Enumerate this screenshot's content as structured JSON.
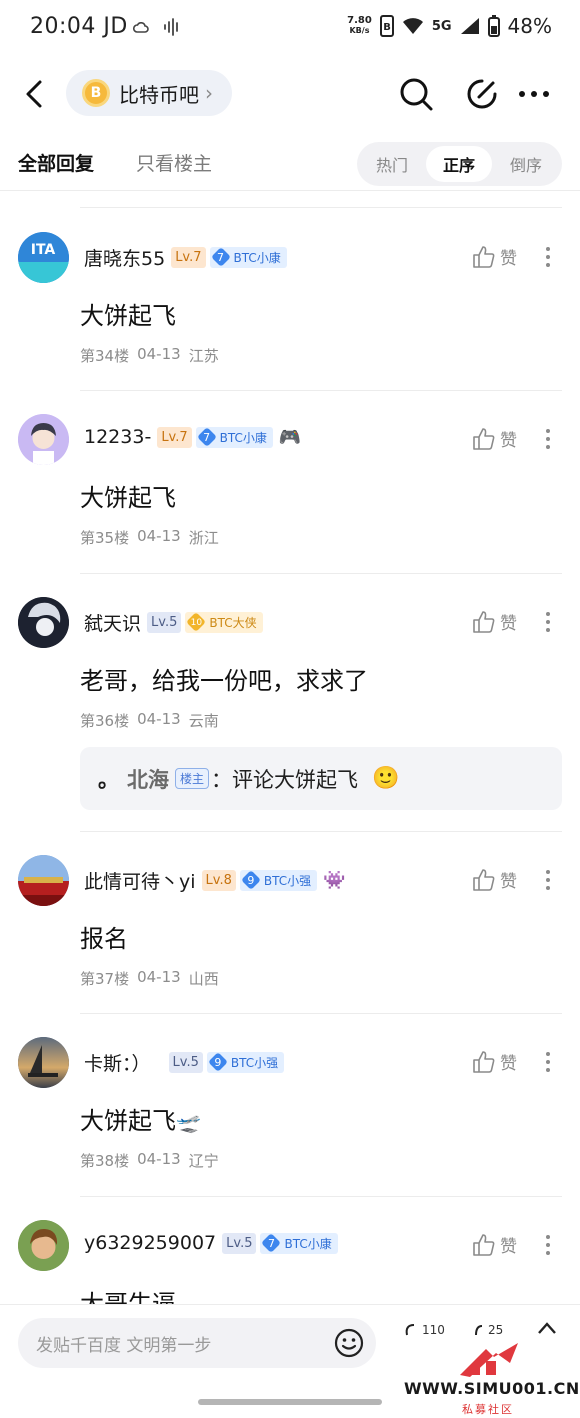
{
  "status_bar": {
    "time": "20:04",
    "carrier": "JD",
    "net_speed_value": "7.80",
    "net_speed_unit": "KB/s",
    "network": "5G",
    "battery": "48%"
  },
  "header": {
    "forum_name": "比特币吧",
    "forum_logo_glyph": "B",
    "chevron": "›"
  },
  "tabs": {
    "all_replies": "全部回复",
    "op_only": "只看楼主",
    "sort_options": [
      "热门",
      "正序",
      "倒序"
    ],
    "active_sort": "正序"
  },
  "posts": [
    {
      "username": "唐晓东55",
      "level": "Lv.7",
      "badge_number": "7",
      "badge_label": "BTC小康",
      "extra_icon": "",
      "content": "大饼起飞",
      "floor": "第34楼",
      "date": "04-13",
      "location": "江苏",
      "like_label": "赞"
    },
    {
      "username": "12233-",
      "level": "Lv.7",
      "badge_number": "7",
      "badge_label": "BTC小康",
      "extra_icon": "🎮",
      "content": "大饼起飞",
      "floor": "第35楼",
      "date": "04-13",
      "location": "浙江",
      "like_label": "赞"
    },
    {
      "username": "弑天识",
      "level": "Lv.5",
      "badge_number": "10",
      "badge_label": "BTC大侠",
      "extra_icon": "",
      "content": "老哥，给我一份吧，求求了",
      "floor": "第36楼",
      "date": "04-13",
      "location": "云南",
      "like_label": "赞",
      "reply": {
        "dot": "。",
        "user": "北海",
        "op_tag": "楼主",
        "text": "：评论大饼起飞",
        "emoji": "🙂"
      }
    },
    {
      "username": "此情可待丶yi",
      "level": "Lv.8",
      "badge_number": "9",
      "badge_label": "BTC小强",
      "extra_icon": "👾",
      "content": "报名",
      "floor": "第37楼",
      "date": "04-13",
      "location": "山西",
      "like_label": "赞"
    },
    {
      "username": "卡斯：）",
      "level": "Lv.5",
      "badge_number": "9",
      "badge_label": "BTC小强",
      "extra_icon": "",
      "content": "大饼起飞",
      "content_emoji": "🛫",
      "floor": "第38楼",
      "date": "04-13",
      "location": "辽宁",
      "like_label": "赞"
    },
    {
      "username": "y6329259007",
      "level": "Lv.5",
      "badge_number": "7",
      "badge_label": "BTC小康",
      "extra_icon": "",
      "content": "大哥牛逼",
      "like_label": "赞"
    }
  ],
  "bottom_bar": {
    "placeholder": "发贴千百度 文明第一步",
    "comments_count": "110",
    "likes_count": "25"
  },
  "watermark": {
    "site": "WWW.SIMU001.CN",
    "sub": "私募社区"
  }
}
